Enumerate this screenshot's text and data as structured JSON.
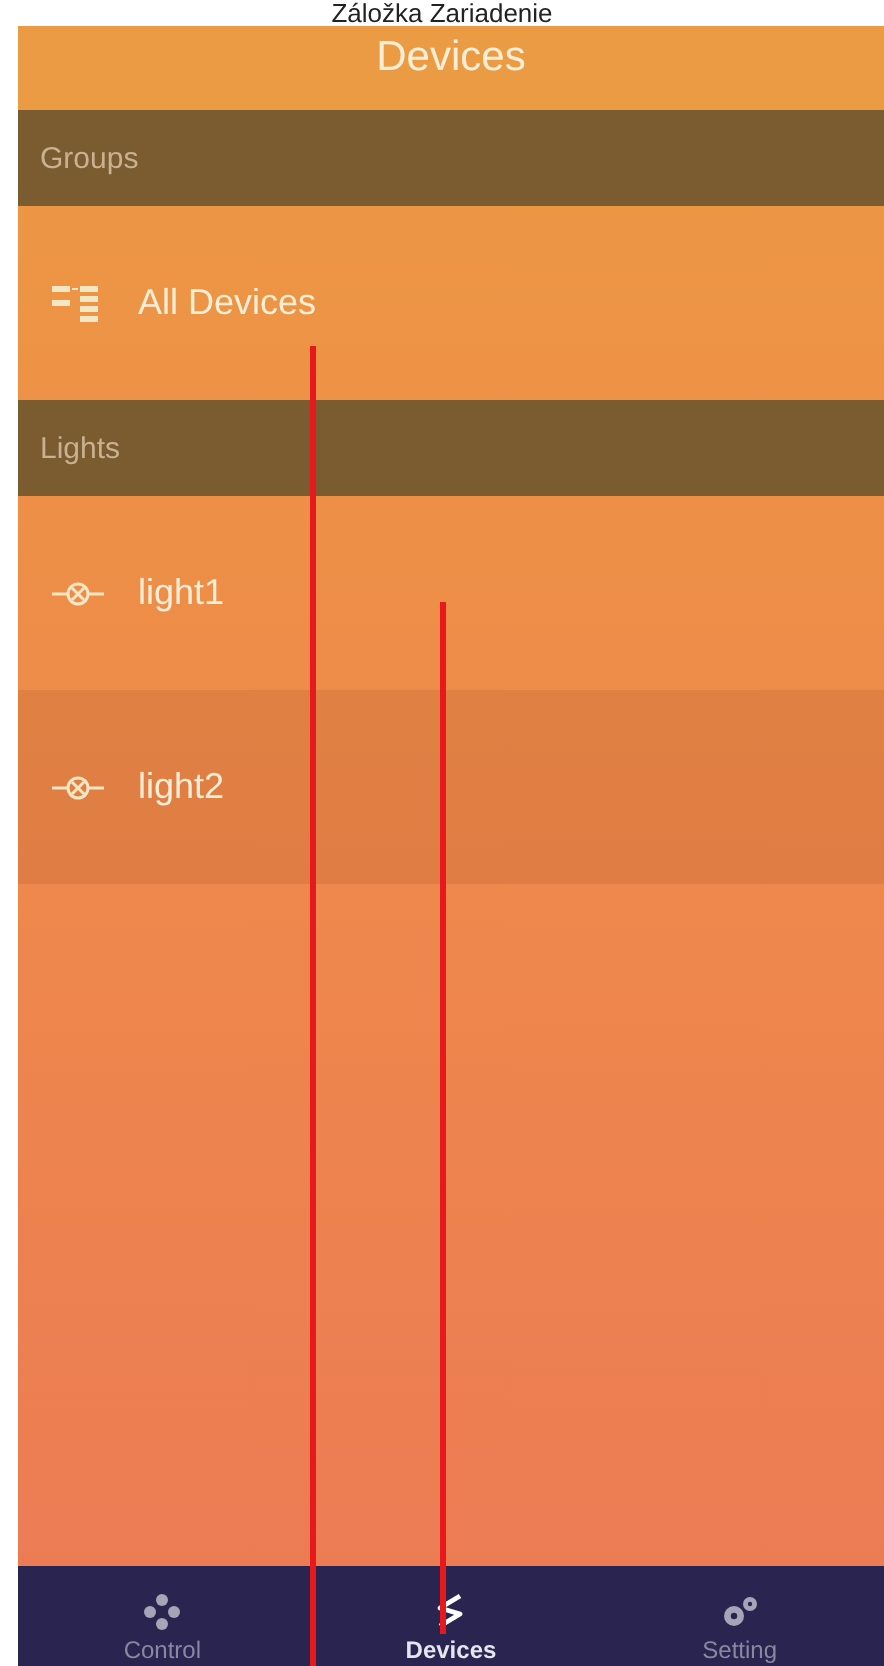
{
  "caption": "Záložka Zariadenie",
  "title": "Devices",
  "sections": [
    {
      "header": "Groups",
      "items": [
        {
          "kind": "group",
          "label": "All Devices",
          "selected": false
        }
      ]
    },
    {
      "header": "Lights",
      "items": [
        {
          "kind": "light",
          "label": "light1",
          "selected": false
        },
        {
          "kind": "light",
          "label": "light2",
          "selected": true
        }
      ]
    }
  ],
  "tabs": [
    {
      "kind": "control",
      "label": "Control",
      "selected": false
    },
    {
      "kind": "devices",
      "label": "Devices",
      "selected": true
    },
    {
      "kind": "setting",
      "label": "Setting",
      "selected": false
    }
  ]
}
